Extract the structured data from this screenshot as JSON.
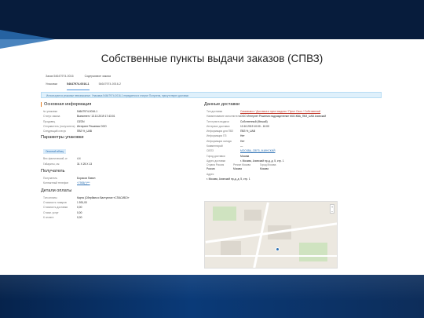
{
  "slide": {
    "title": "Собственные пункты выдачи заказов (СПВЗ)"
  },
  "screenshot": {
    "tabs": [
      "Заказ 54647974-0016",
      "Содержимое заказа"
    ],
    "subtabs": [
      "Упаковки",
      "54647974-0016-1",
      "54647974-0016-2"
    ],
    "notice": "Используются упаковки невозможные. Упаковка 54647974-0016-1 передается в статусе Получена, присутствуют доставки",
    "main_info": {
      "title": "Основная информация",
      "rows": [
        {
          "k": "№ упаковки",
          "v": "54647974-0016-1"
        },
        {
          "k": "Статус заказа",
          "v": "Выполнен / 13.10.2019 17:43:01"
        },
        {
          "k": "Продавец",
          "v": "OZON"
        },
        {
          "k": "Отправитель (получатель)",
          "v": "Интернет Решения ООО"
        },
        {
          "k": "Следующий статус",
          "v": "ПВЗ %_UAB"
        }
      ]
    },
    "package_params": {
      "title": "Параметры упаковки",
      "pill": "Опасный абзац",
      "rows": [
        {
          "k": "Вес фактический, кг",
          "v": "4.4"
        },
        {
          "k": "Габариты, см",
          "v": "31 X 25 X 13"
        }
      ]
    },
    "recipient": {
      "title": "Получатель",
      "rows": [
        {
          "k": "Получатель",
          "v": "Борисов Павел"
        },
        {
          "k": "Контактный телефон",
          "v": "+7905(*)***"
        }
      ]
    },
    "payment": {
      "title": "Детали оплаты",
      "rows": [
        {
          "k": "Тип оплаты",
          "v": "Карта (Сбербанк и Валтусное «СПАСИБО»"
        },
        {
          "k": "Стоимость товаров",
          "v": "1 591,00"
        },
        {
          "k": "Стоимость доставки",
          "v": "0,00"
        },
        {
          "k": "Стоим. услуг",
          "v": "0,00"
        },
        {
          "k": "К оплате",
          "v": "0,00"
        }
      ]
    },
    "delivery": {
      "title": "Данные доставки",
      "rows": [
        {
          "k": "Тип доставки",
          "v": "Самовывоз / Доставка в пункт выдачи / Пункт Ozon / Собственный",
          "style": "link"
        },
        {
          "k": "Наименование исполнителя",
          "v": "ООО Интернет Решения подразделение МОСКВА_ПВЗ_UAB Ачинский"
        },
        {
          "k": "Тип пункта выдачи",
          "v": "Собственный (Меша8)"
        },
        {
          "k": "Интервал доставки",
          "v": "13.10.2019 10:00 - 10:00"
        },
        {
          "k": "Информация для ПВЗ",
          "v": "ПВЗ %_UAB"
        },
        {
          "k": "Информация ПЗ",
          "v": "Нет"
        },
        {
          "k": "Информация склада",
          "v": "Нет"
        },
        {
          "k": "Комментарий",
          "v": "—"
        },
        {
          "k": "СВПЗ",
          "v": "МОСКВА_СВПЗ_АЧИНСКИЙ",
          "style": "blue"
        },
        {
          "k": "Город доставки",
          "v": "Москва"
        },
        {
          "k": "Адрес доставки",
          "v": "г. Москва, Ачинский пр-д, д. 5, стр. 1"
        }
      ],
      "split_head": [
        "Страна Россия",
        "Регион Москва",
        "Город Москва"
      ],
      "split_vals": [
        "Россия",
        "Москва",
        "Москва"
      ],
      "address_label": "Адрес",
      "address_value": "г. Москва, Ачинский пр-д, д. 5, стр. 1"
    }
  }
}
